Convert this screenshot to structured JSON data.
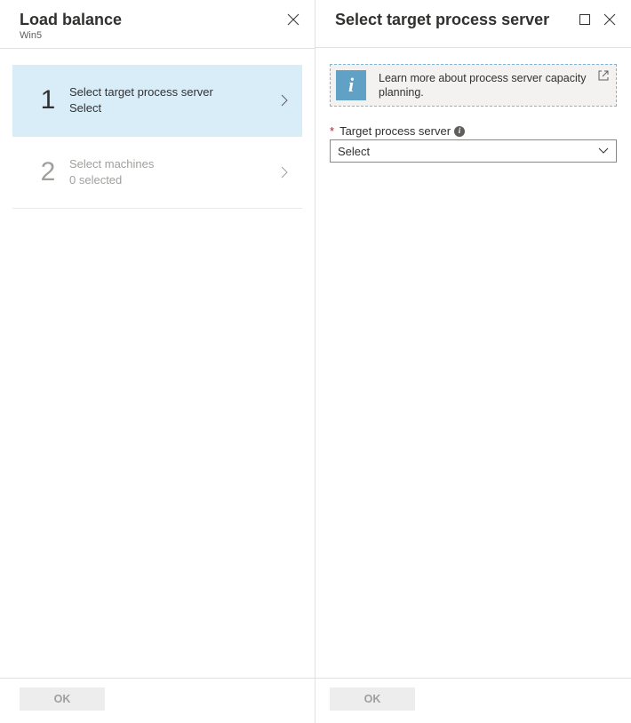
{
  "left_panel": {
    "title": "Load balance",
    "subtitle": "Win5",
    "steps": [
      {
        "num": "1",
        "title": "Select target process server",
        "sub": "Select"
      },
      {
        "num": "2",
        "title": "Select machines",
        "sub": "0 selected"
      }
    ],
    "ok_label": "OK"
  },
  "right_panel": {
    "title": "Select target process server",
    "info_text": "Learn more about process server capacity planning.",
    "field": {
      "label": "Target process server",
      "value": "Select"
    },
    "ok_label": "OK"
  }
}
